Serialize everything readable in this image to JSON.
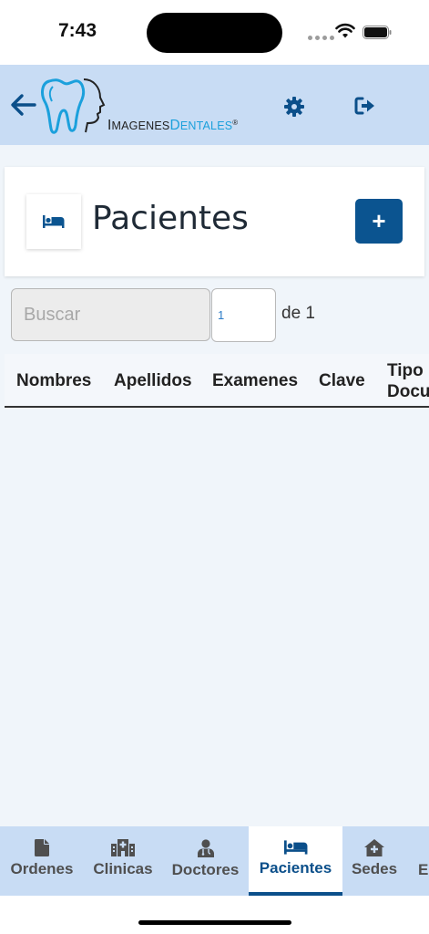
{
  "status_bar": {
    "time": "7:43"
  },
  "header": {
    "logo": {
      "text_prefix_big": "I",
      "text_prefix": "MAGENES",
      "text_suffix_big": "D",
      "text_suffix": "ENTALES",
      "registered": "®"
    }
  },
  "page": {
    "title": "Pacientes",
    "add_label": "+"
  },
  "search": {
    "placeholder": "Buscar",
    "value": ""
  },
  "pagination": {
    "current_page": "1",
    "total_label": "de 1"
  },
  "table": {
    "columns": [
      "Nombres",
      "Apellidos",
      "Examenes",
      "Clave",
      "Tipo",
      "Docu"
    ]
  },
  "bottom_nav": {
    "items": [
      {
        "label": "Ordenes",
        "icon": "file-icon"
      },
      {
        "label": "Clinicas",
        "icon": "hospital-icon"
      },
      {
        "label": "Doctores",
        "icon": "doctor-icon"
      },
      {
        "label": "Pacientes",
        "icon": "bed-icon",
        "active": true
      },
      {
        "label": "Sedes",
        "icon": "clinic-icon"
      },
      {
        "label": "Ei",
        "icon": ""
      }
    ]
  },
  "colors": {
    "header_bg": "#c8dcf4",
    "primary": "#0b5490",
    "content_bg": "#f0f5fa"
  }
}
